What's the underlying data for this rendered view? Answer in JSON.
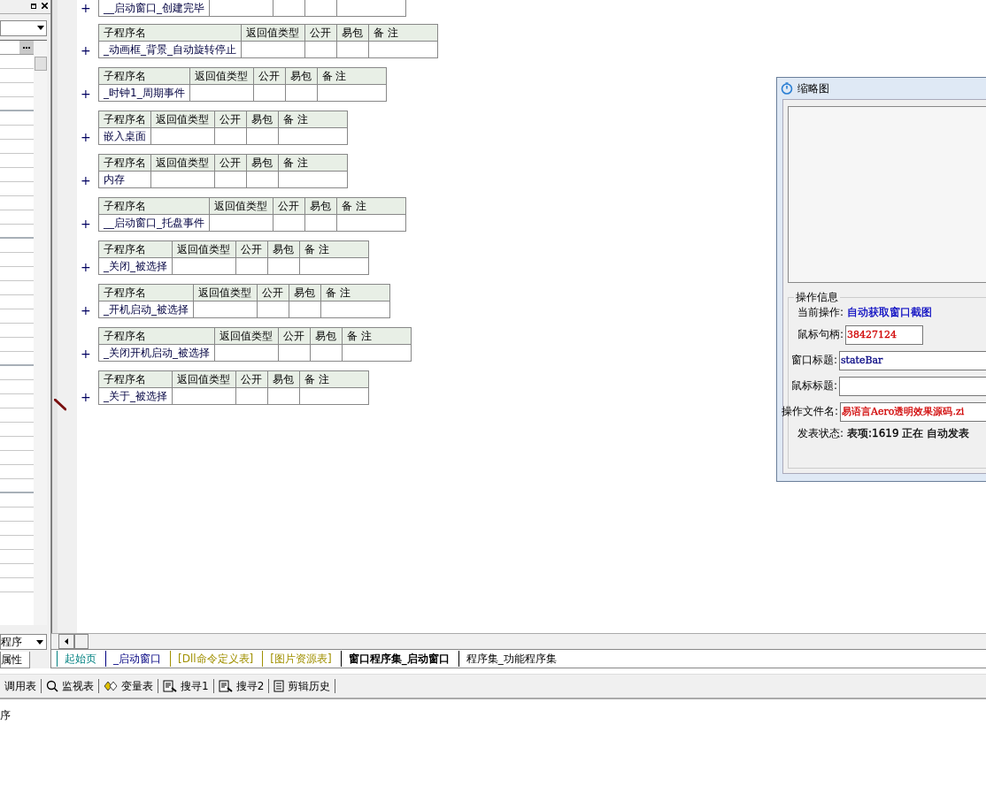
{
  "left_panel": {
    "bottom_dropdown": "程序",
    "tab": "属性"
  },
  "partial_row": {
    "expander": "+",
    "name": "__启动窗口_创建完毕"
  },
  "procedures": [
    {
      "expander": "+",
      "name": "_动画框_背景_自动旋转停止",
      "current": false,
      "columns": [
        "子程序名",
        "返回值类型",
        "公开",
        "易包",
        "备 注"
      ]
    },
    {
      "expander": "+",
      "name": "_时钟1_周期事件",
      "current": false,
      "columns": [
        "子程序名",
        "返回值类型",
        "公开",
        "易包",
        "备 注"
      ]
    },
    {
      "expander": "+",
      "name": "嵌入桌面",
      "current": false,
      "columns": [
        "子程序名",
        "返回值类型",
        "公开",
        "易包",
        "备 注"
      ]
    },
    {
      "expander": "+",
      "name": "内存",
      "current": false,
      "columns": [
        "子程序名",
        "返回值类型",
        "公开",
        "易包",
        "备 注"
      ]
    },
    {
      "expander": "+",
      "name": "__启动窗口_托盘事件",
      "current": false,
      "columns": [
        "子程序名",
        "返回值类型",
        "公开",
        "易包",
        "备 注"
      ]
    },
    {
      "expander": "+",
      "name": "_关闭_被选择",
      "current": false,
      "columns": [
        "子程序名",
        "返回值类型",
        "公开",
        "易包",
        "备 注"
      ]
    },
    {
      "expander": "+",
      "name": "_开机启动_被选择",
      "current": false,
      "columns": [
        "子程序名",
        "返回值类型",
        "公开",
        "易包",
        "备 注"
      ]
    },
    {
      "expander": "+",
      "name": "_关闭开机启动_被选择",
      "current": false,
      "columns": [
        "子程序名",
        "返回值类型",
        "公开",
        "易包",
        "备 注"
      ]
    },
    {
      "expander": "+",
      "name": "_关于_被选择",
      "current": true,
      "columns": [
        "子程序名",
        "返回值类型",
        "公开",
        "易包",
        "备 注"
      ]
    }
  ],
  "tabs": [
    {
      "label": "起始页",
      "selected": false,
      "color": "#008080"
    },
    {
      "label": "_启动窗口",
      "selected": false,
      "color": "#000080"
    },
    {
      "label": "[Dll命令定义表]",
      "selected": false,
      "color": "#a09000"
    },
    {
      "label": "[图片资源表]",
      "selected": false,
      "color": "#a09000"
    },
    {
      "label": "窗口程序集_启动窗口",
      "selected": true,
      "color": "#000000"
    },
    {
      "label": "程序集_功能程序集",
      "selected": false,
      "color": "#000000"
    }
  ],
  "toolbar": [
    {
      "kind": "plain",
      "label": "调用表"
    },
    {
      "kind": "search",
      "label": "监视表"
    },
    {
      "kind": "variables",
      "label": "变量表"
    },
    {
      "kind": "find",
      "label": "搜寻1"
    },
    {
      "kind": "find",
      "label": "搜寻2"
    },
    {
      "kind": "clipboard",
      "label": "剪辑历史"
    }
  ],
  "output": {
    "text": "序"
  },
  "thumbnail_window": {
    "title": "缩略图",
    "group_title": "操作信息",
    "fields": [
      {
        "kind": "text",
        "label": "当前操作:",
        "value": "自动获取窗口截图",
        "color": "#0000c0"
      },
      {
        "kind": "shortfield",
        "label": "鼠标句柄:",
        "value": "38427124",
        "color": "#d00000"
      },
      {
        "kind": "field",
        "label": "窗口标题:",
        "value": "stateBar",
        "color": "#000080"
      },
      {
        "kind": "field",
        "label": "鼠标标题:"
      },
      {
        "kind": "field",
        "label": "操作文件名:",
        "value": "易语言Aero透明效果源码.zi",
        "color": "#d00000"
      },
      {
        "kind": "text",
        "label": "发表状态:",
        "value": "表项:1619 正在 自动发表",
        "color": "#000000"
      }
    ]
  }
}
